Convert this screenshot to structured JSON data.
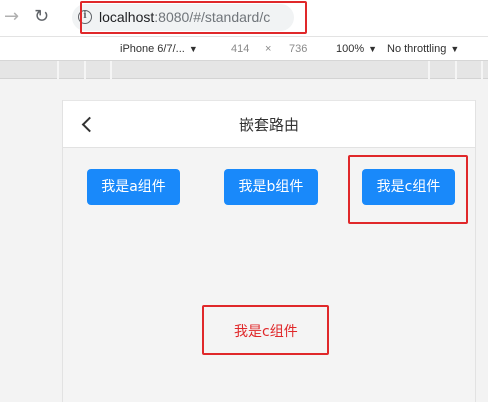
{
  "browser": {
    "back_icon": "arrow-left-icon",
    "reload_icon": "reload-icon",
    "info_icon": "info-icon",
    "url_host": "localhost",
    "url_path": ":8080/#/standard/c"
  },
  "device_toolbar": {
    "device": "iPhone 6/7/...",
    "width": "414",
    "times": "×",
    "height": "736",
    "zoom": "100%",
    "throttling": "No throttling"
  },
  "app": {
    "back_icon": "chevron-left-icon",
    "title": "嵌套路由",
    "buttons": [
      {
        "label": "我是a组件"
      },
      {
        "label": "我是b组件"
      },
      {
        "label": "我是c组件"
      }
    ],
    "child_text": "我是c组件",
    "accent_color": "#1989fa",
    "highlight_color": "#e0282a"
  }
}
